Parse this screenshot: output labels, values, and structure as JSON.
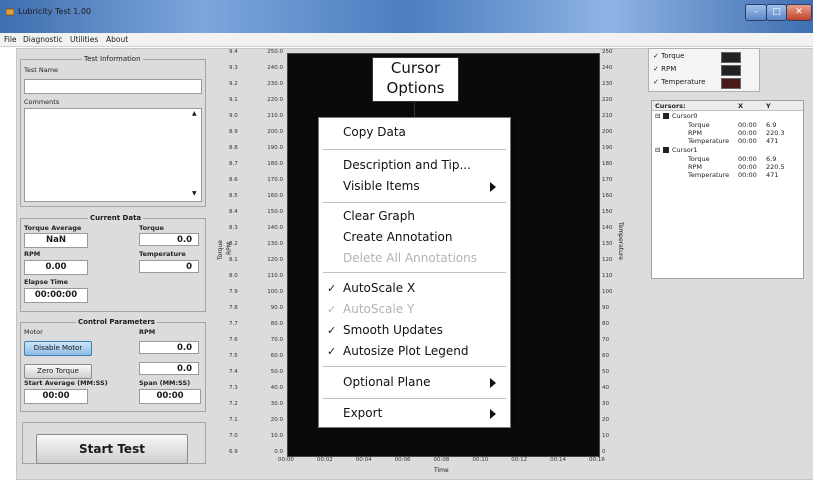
{
  "window": {
    "title": "Lubricity Test 1.00",
    "min_glyph": "–",
    "max_glyph": "□",
    "close_glyph": "✕"
  },
  "menu": [
    "File",
    "Diagnostic",
    "Utilities",
    "About"
  ],
  "test_info": {
    "group_title": "Test Information",
    "test_name_label": "Test Name",
    "test_name_value": "",
    "comments_label": "Comments",
    "comments_value": ""
  },
  "current_data": {
    "group_title": "Current Data",
    "torque_average_label": "Torque Average",
    "torque_average_value": "NaN",
    "torque_label": "Torque",
    "torque_value": "0.0",
    "rpm_label": "RPM",
    "rpm_value": "0.00",
    "temperature_label": "Temperature",
    "temperature_value": "0",
    "elapse_time_label": "Elapse Time",
    "elapse_time_value": "00:00:00"
  },
  "control_params": {
    "group_title": "Control Parameters",
    "motor_label": "Motor",
    "rpm_label": "RPM",
    "disable_motor_button": "Disable Motor",
    "rpm_value": "0.0",
    "zero_torque_button": "Zero Torque",
    "torque_zero_value": "0.0",
    "start_average_label": "Start Average (MM:SS)",
    "start_average_value": "00:00",
    "span_label": "Span (MM:SS)",
    "span_value": "00:00"
  },
  "start_test_button": "Start Test",
  "graph": {
    "outer_ticks": [
      "9.4",
      "9.3",
      "9.2",
      "9.1",
      "9.0",
      "8.9",
      "8.8",
      "8.7",
      "8.6",
      "8.5",
      "8.4",
      "8.3",
      "8.2",
      "8.1",
      "8.0",
      "7.9",
      "7.8",
      "7.7",
      "7.6",
      "7.5",
      "7.4",
      "7.3",
      "7.2",
      "7.1",
      "7.0",
      "6.9"
    ],
    "rpm_ticks": [
      "250.0",
      "240.0",
      "230.0",
      "220.0",
      "210.0",
      "200.0",
      "190.0",
      "180.0",
      "170.0",
      "160.0",
      "150.0",
      "140.0",
      "130.0",
      "120.0",
      "110.0",
      "100.0",
      "90.0",
      "80.0",
      "70.0",
      "60.0",
      "50.0",
      "40.0",
      "30.0",
      "20.0",
      "10.0",
      "0.0"
    ],
    "temp_ticks": [
      "250",
      "240",
      "230",
      "220",
      "210",
      "200",
      "190",
      "180",
      "170",
      "160",
      "150",
      "140",
      "130",
      "120",
      "110",
      "100",
      "90",
      "80",
      "70",
      "60",
      "50",
      "40",
      "30",
      "20",
      "10",
      "0"
    ],
    "x_ticks": [
      "00:00",
      "00:02",
      "00:04",
      "00:06",
      "00:08",
      "00:10",
      "00:12",
      "00:14",
      "00:16"
    ],
    "x_label": "Time",
    "y_label_torque": "Torque",
    "y_label_rpm": "RPM",
    "y_label_temp": "Temperature"
  },
  "legend": [
    {
      "name": "Torque",
      "check": "✓"
    },
    {
      "name": "RPM",
      "check": "✓"
    },
    {
      "name": "Temperature",
      "check": "✓"
    }
  ],
  "cursors_table": {
    "headers": [
      "Cursors:",
      "X",
      "Y"
    ],
    "cursor0": "Cursor0",
    "cursor1": "Cursor1",
    "rows0": [
      {
        "name": "Torque",
        "x": "00:00",
        "y": "6.9"
      },
      {
        "name": "RPM",
        "x": "00:00",
        "y": "220.3"
      },
      {
        "name": "Temperature",
        "x": "00:00",
        "y": "471"
      }
    ],
    "rows1": [
      {
        "name": "Torque",
        "x": "00:00",
        "y": "6.9"
      },
      {
        "name": "RPM",
        "x": "00:00",
        "y": "220.5"
      },
      {
        "name": "Temperature",
        "x": "00:00",
        "y": "471"
      }
    ]
  },
  "context_menu": {
    "copy_data": "Copy Data",
    "description": "Description and Tip...",
    "visible_items": "Visible Items",
    "clear_graph": "Clear Graph",
    "create_annotation": "Create Annotation",
    "delete_annotations": "Delete All Annotations",
    "autoscale_x": "AutoScale X",
    "autoscale_y": "AutoScale Y",
    "smooth_updates": "Smooth Updates",
    "autosize_legend": "Autosize Plot Legend",
    "optional_plane": "Optional Plane",
    "export": "Export",
    "check": "✓"
  },
  "callout": {
    "line1": "Cursor",
    "line2": "Options"
  }
}
